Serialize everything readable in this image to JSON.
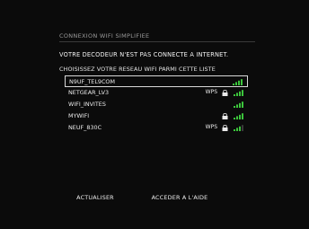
{
  "header": {
    "title": "CONNEXION WIFI SIMPLIFIEE"
  },
  "message": "VOTRE DECODEUR N'EST PAS CONNECTE A INTERNET.",
  "instruction": "CHOISISSEZ VOTRE RESEAU WIFI PARMI CETTE LISTE",
  "networks": [
    {
      "name": "N9UF_TEL9COM",
      "wps": "",
      "locked": false,
      "signal_bars": 4,
      "selected": true
    },
    {
      "name": "NETGEAR_LV3",
      "wps": "WPS",
      "locked": true,
      "signal_bars": 4,
      "selected": false
    },
    {
      "name": "WIFI_INVITES",
      "wps": "",
      "locked": false,
      "signal_bars": 4,
      "selected": false
    },
    {
      "name": "MYWIFI",
      "wps": "",
      "locked": true,
      "signal_bars": 4,
      "selected": false
    },
    {
      "name": "NEUF_830C",
      "wps": "WPS",
      "locked": true,
      "signal_bars": 3,
      "selected": false
    }
  ],
  "buttons": {
    "refresh": "ACTUALISER",
    "help": "ACCEDER A L'AIDE"
  },
  "colors": {
    "signal": "#3cc63c",
    "signal_off": "#3a3a3a",
    "selection": "#d9d9d9"
  }
}
